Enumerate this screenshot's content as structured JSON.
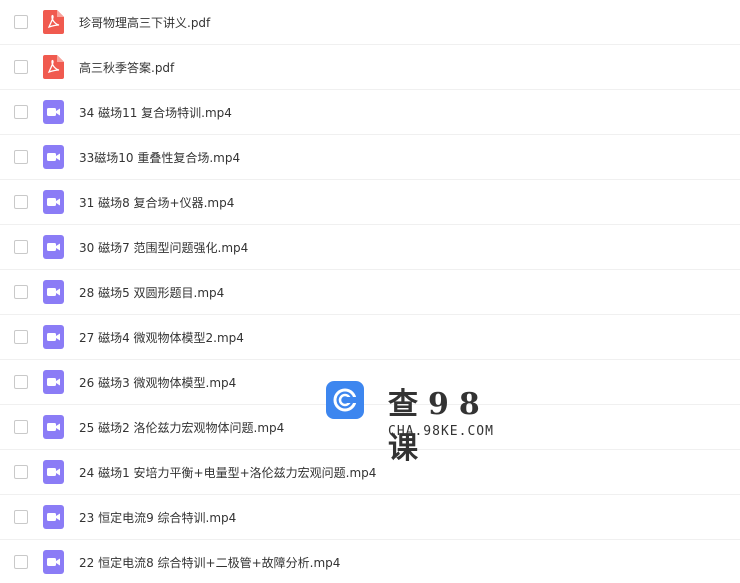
{
  "files": [
    {
      "name": "珍哥物理高三下讲义.pdf",
      "type": "pdf"
    },
    {
      "name": "高三秋季答案.pdf",
      "type": "pdf"
    },
    {
      "name": "34 磁场11 复合场特训.mp4",
      "type": "video"
    },
    {
      "name": "33磁场10 重叠性复合场.mp4",
      "type": "video"
    },
    {
      "name": "31 磁场8 复合场+仪器.mp4",
      "type": "video"
    },
    {
      "name": "30 磁场7 范围型问题强化.mp4",
      "type": "video"
    },
    {
      "name": "28 磁场5 双圆形题目.mp4",
      "type": "video"
    },
    {
      "name": "27 磁场4 微观物体模型2.mp4",
      "type": "video"
    },
    {
      "name": "26 磁场3 微观物体模型.mp4",
      "type": "video"
    },
    {
      "name": "25 磁场2 洛伦兹力宏观物体问题.mp4",
      "type": "video"
    },
    {
      "name": "24 磁场1 安培力平衡+电量型+洛伦兹力宏观问题.mp4",
      "type": "video"
    },
    {
      "name": "23 恒定电流9 综合特训.mp4",
      "type": "video"
    },
    {
      "name": "22 恒定电流8 综合特训+二极管+故障分析.mp4",
      "type": "video"
    }
  ],
  "colors": {
    "pdf_icon": "#f05a4f",
    "video_icon": "#8b7cf6",
    "watermark_logo": "#3d86ef"
  },
  "watermark": {
    "title": "查98课",
    "url": "CHA.98KE.COM"
  }
}
